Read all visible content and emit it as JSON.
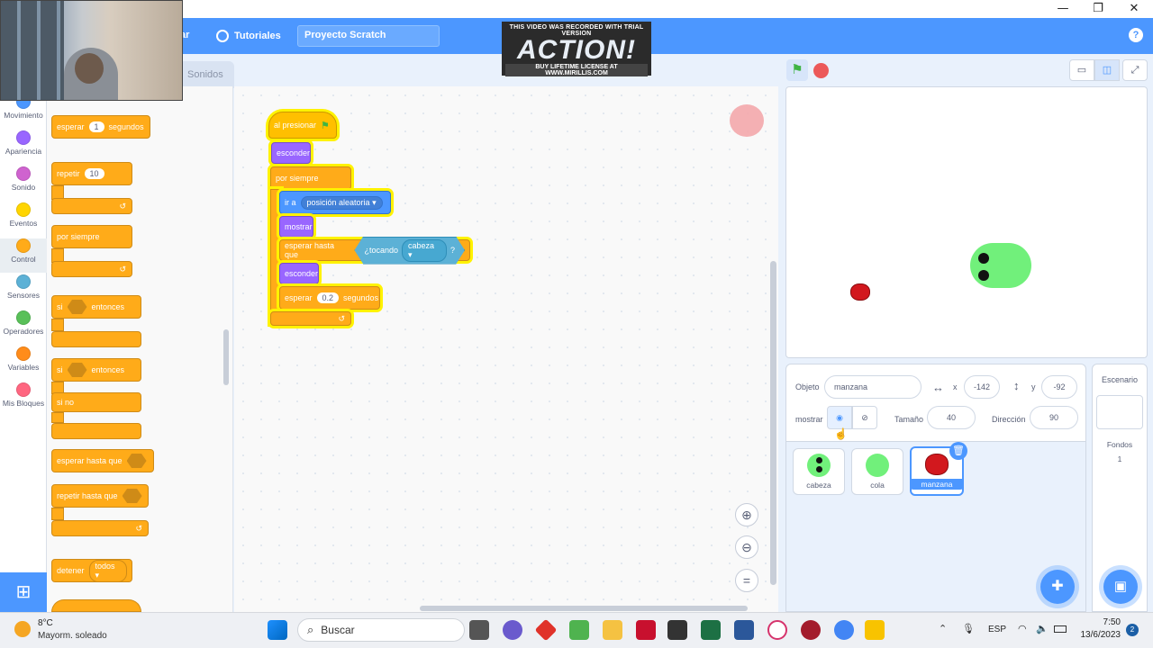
{
  "menu": {
    "partial_label": "ar",
    "tutorials": "Tutoriales",
    "project_title": "Proyecto Scratch",
    "help": "?"
  },
  "watermark": {
    "top": "THIS VIDEO WAS RECORDED WITH TRIAL VERSION",
    "logo": "ACTION!",
    "bottom": "BUY LIFETIME LICENSE AT WWW.MIRILLIS.COM"
  },
  "window": {
    "minimize": "—",
    "maximize": "❐",
    "close": "✕"
  },
  "tabs": {
    "sounds": "Sonidos"
  },
  "categories": [
    {
      "label": "Movimiento",
      "color": "#4c97ff"
    },
    {
      "label": "Apariencia",
      "color": "#9966ff"
    },
    {
      "label": "Sonido",
      "color": "#cf63cf"
    },
    {
      "label": "Eventos",
      "color": "#ffd500"
    },
    {
      "label": "Control",
      "color": "#ffab19"
    },
    {
      "label": "Sensores",
      "color": "#5cb1d6"
    },
    {
      "label": "Operadores",
      "color": "#59c059"
    },
    {
      "label": "Variables",
      "color": "#ff8c1a"
    },
    {
      "label": "Mis Bloques",
      "color": "#ff6680"
    }
  ],
  "palette": {
    "wait": "esperar",
    "wait_value": "1",
    "wait_unit": "segundos",
    "repeat": "repetir",
    "repeat_value": "10",
    "forever": "por siempre",
    "if": "si",
    "then": "entonces",
    "if2": "si",
    "then2": "entonces",
    "else": "si no",
    "wait_until": "esperar hasta que",
    "repeat_until": "repetir hasta que",
    "stop": "detener",
    "stop_value": "todos"
  },
  "script": {
    "when_flag": "al presionar",
    "hide": "esconder",
    "forever": "por siempre",
    "goto": "ir a",
    "goto_target": "posición aleatoria",
    "show": "mostrar",
    "wait_until": "esperar hasta que",
    "touching": "¿tocando",
    "touching_target": "cabeza",
    "q": "?",
    "hide2": "esconder",
    "wait": "esperar",
    "wait_value": "0.2",
    "wait_unit": "segundos"
  },
  "sprite_info": {
    "object_label": "Objeto",
    "object_name": "manzana",
    "x_label": "x",
    "x_value": "-142",
    "y_label": "y",
    "y_value": "-92",
    "show_label": "mostrar",
    "size_label": "Tamaño",
    "size_value": "40",
    "direction_label": "Dirección",
    "direction_value": "90"
  },
  "sprites": [
    {
      "name": "cabeza"
    },
    {
      "name": "cola"
    },
    {
      "name": "manzana"
    }
  ],
  "stage_panel": {
    "title": "Escenario",
    "backdrops_label": "Fondos",
    "backdrops_count": "1"
  },
  "taskbar": {
    "weather_temp": "8°C",
    "weather_desc": "Mayorm. soleado",
    "search": "Buscar",
    "lang": "ESP",
    "time": "7:50",
    "date": "13/6/2023",
    "notif": "2"
  }
}
